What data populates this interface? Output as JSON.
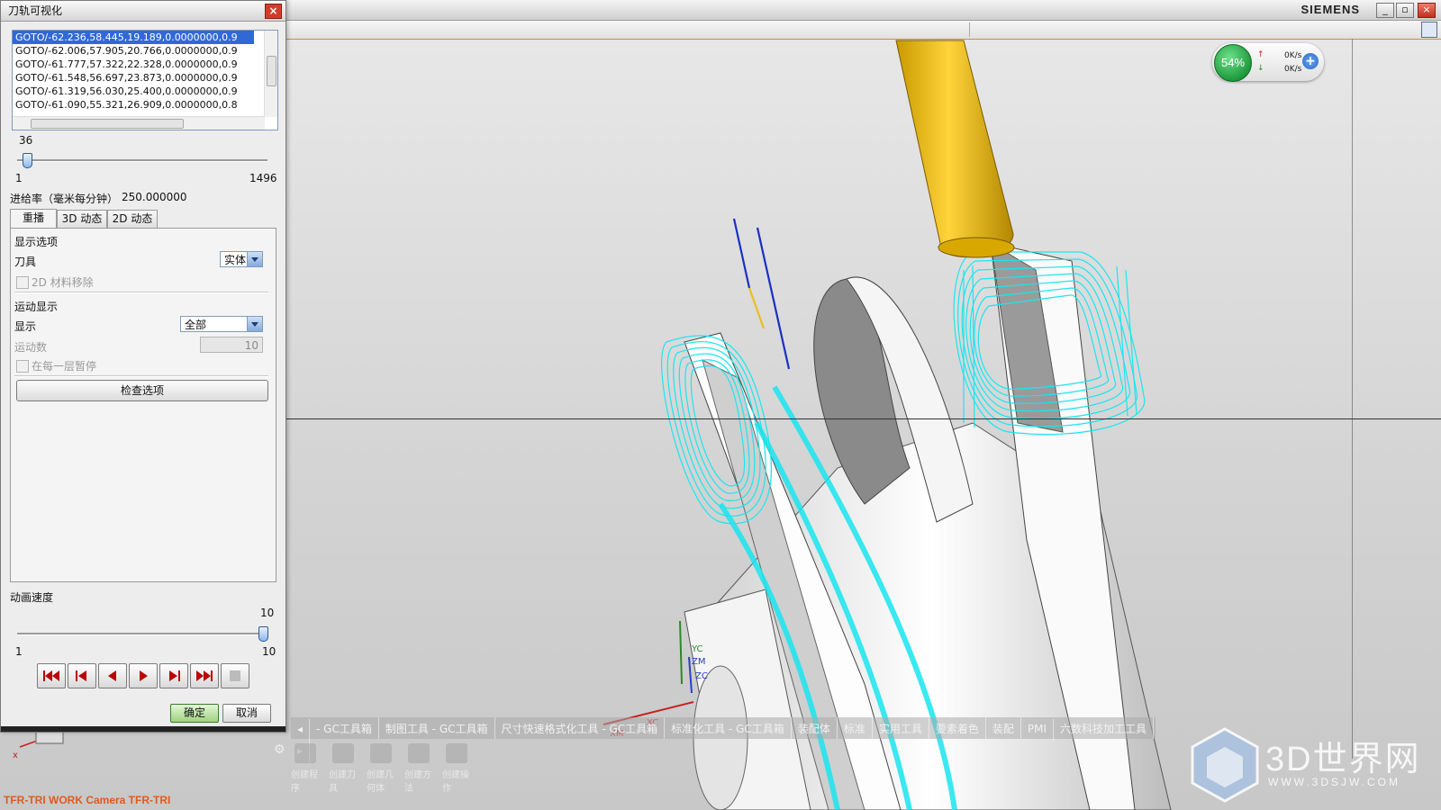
{
  "window": {
    "brand": "SIEMENS",
    "minimize": "_",
    "restore": "▫",
    "close": "×"
  },
  "dialog": {
    "title": "刀轨可视化",
    "close_glyph": "×",
    "list_rows": [
      "GOTO/-62.236,58.445,19.189,0.0000000,0.9",
      "GOTO/-62.006,57.905,20.766,0.0000000,0.9",
      "GOTO/-61.777,57.322,22.328,0.0000000,0.9",
      "GOTO/-61.548,56.697,23.873,0.0000000,0.9",
      "GOTO/-61.319,56.030,25.400,0.0000000,0.9",
      "GOTO/-61.090,55.321,26.909,0.0000000,0.8"
    ],
    "motion_slider": {
      "current": "36",
      "min": "1",
      "max": "1496",
      "value": 36,
      "min_value": 1,
      "max_value": 1496
    },
    "feed_rate_label": "进给率（毫米每分钟）",
    "feed_rate_value": "250.000000",
    "tabs": [
      "重播",
      "3D 动态",
      "2D 动态"
    ],
    "display_options_heading": "显示选项",
    "tool_label": "刀具",
    "tool_value": "实体",
    "material_removal_2d": "2D 材料移除",
    "motion_display_heading": "运动显示",
    "display_label": "显示",
    "display_value": "全部",
    "motion_count_label": "运动数",
    "motion_count_value": "10",
    "pause_each_layer": "在每一层暂停",
    "check_options_button": "检查选项",
    "animation_speed_label": "动画速度",
    "speed_slider": {
      "current": "10",
      "min": "1",
      "max": "10",
      "value": 10,
      "min_value": 1,
      "max_value": 10
    },
    "ok": "确定",
    "cancel": "取消"
  },
  "network": {
    "percent": "54%",
    "up": "0K/s",
    "down": "0K/s",
    "up_arrow": "↑",
    "down_arrow": "↓",
    "plus": "+"
  },
  "bottom_toolbar": {
    "items": [
      "◂",
      "- GC工具箱",
      "制图工具 - GC工具箱",
      "尺寸快速格式化工具 - GC工具箱",
      "标准化工具 - GC工具箱",
      "装配体",
      "标准",
      "实用工具",
      "要素着色",
      "装配",
      "PMI",
      "六数科技加工工具",
      "▸"
    ],
    "icon_labels": [
      "创建程序",
      "创建刀具",
      "创建几何体",
      "创建方法",
      "创建操作"
    ]
  },
  "camera_label": "TFR-TRI WORK Camera TFR-TRI",
  "axis_labels": {
    "xm": "XM",
    "xc": "XC",
    "zm": "ZM",
    "zc": "ZC",
    "yc": "YC",
    "x": "x"
  },
  "watermark": {
    "title": "3D世界网",
    "url": "WWW.3DSJW.COM"
  },
  "colors": {
    "toolpath": "#19e6f0",
    "tool": "#f0c020",
    "accent": "#3168d5"
  }
}
